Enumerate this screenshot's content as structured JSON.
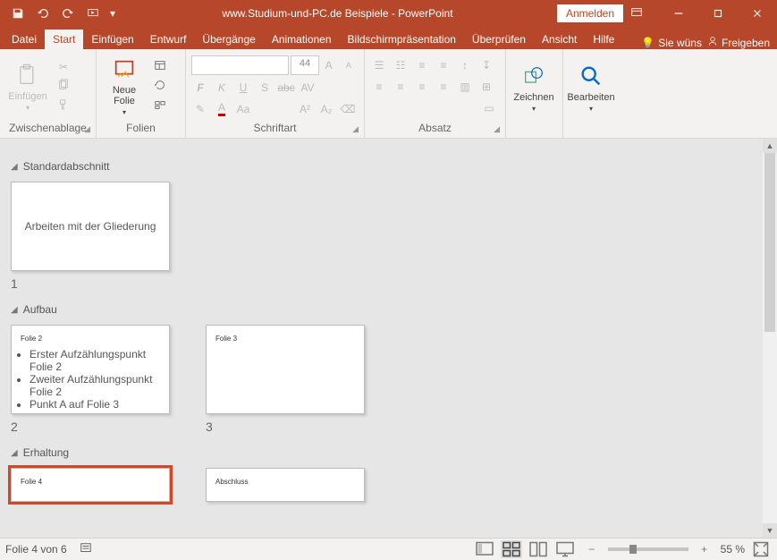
{
  "titlebar": {
    "title": "www.Studium-und-PC.de Beispiele - PowerPoint",
    "signin": "Anmelden"
  },
  "tabs": {
    "file": "Datei",
    "start": "Start",
    "insert": "Einfügen",
    "design": "Entwurf",
    "transitions": "Übergänge",
    "animations": "Animationen",
    "slideshow": "Bildschirmpräsentation",
    "review": "Überprüfen",
    "view": "Ansicht",
    "help": "Hilfe",
    "tell_me": "Sie wüns",
    "share": "Freigeben"
  },
  "ribbon": {
    "clipboard": {
      "label": "Zwischenablage",
      "paste": "Einfügen"
    },
    "slides": {
      "label": "Folien",
      "new_slide": "Neue Folie"
    },
    "font": {
      "label": "Schriftart",
      "size": "44"
    },
    "paragraph": {
      "label": "Absatz"
    },
    "drawing": {
      "label": "Zeichnen"
    },
    "editing": {
      "label": "Bearbeiten"
    }
  },
  "sections": {
    "s1": "Standardabschnitt",
    "s2": "Aufbau",
    "s3": "Erhaltung"
  },
  "slides": {
    "n1": "1",
    "n2": "2",
    "n3": "3",
    "slide1_title": "Arbeiten mit der Gliederung",
    "slide2_title": "Folie 2",
    "slide2_b1": "Erster Aufzählungspunkt Folie 2",
    "slide2_b2": "Zweiter Aufzählungspunkt Folie 2",
    "slide2_b3": "Punkt A auf Folie 3",
    "slide3_title": "Folie 3",
    "slide4_title": "Folie 4",
    "slide5_title": "Abschluss"
  },
  "statusbar": {
    "slide_counter": "Folie 4 von 6",
    "zoom": "55 %"
  }
}
